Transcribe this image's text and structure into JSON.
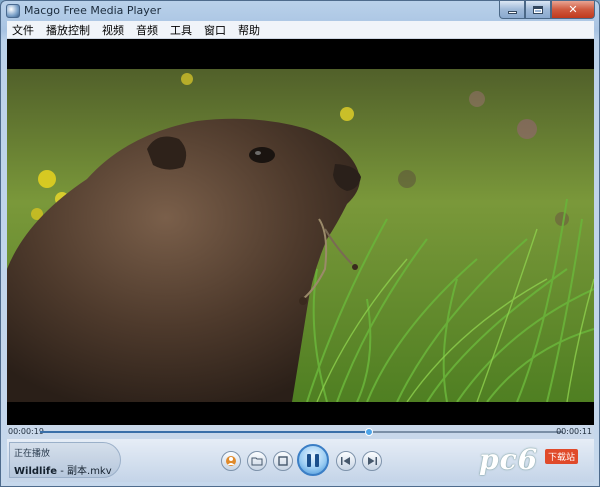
{
  "window": {
    "title": "Macgo Free Media Player"
  },
  "menu": [
    "文件",
    "播放控制",
    "视频",
    "音频",
    "工具",
    "窗口",
    "帮助"
  ],
  "playback": {
    "elapsed": "00:00:19",
    "remaining": "00:00:11",
    "progress": 0.63,
    "status": "正在播放",
    "file_title": "Wildlife",
    "file_suffix": " - 副本.mkv"
  },
  "controls": {
    "icons": [
      "media-library-icon",
      "open-folder-icon",
      "stop-icon",
      "pause-icon",
      "previous-icon",
      "next-icon"
    ]
  },
  "watermark": {
    "text": "pc6",
    "badge": "下载站"
  },
  "colors": {
    "seek_fill": "#3a6fa8",
    "play_button": "#3f8fd6"
  }
}
